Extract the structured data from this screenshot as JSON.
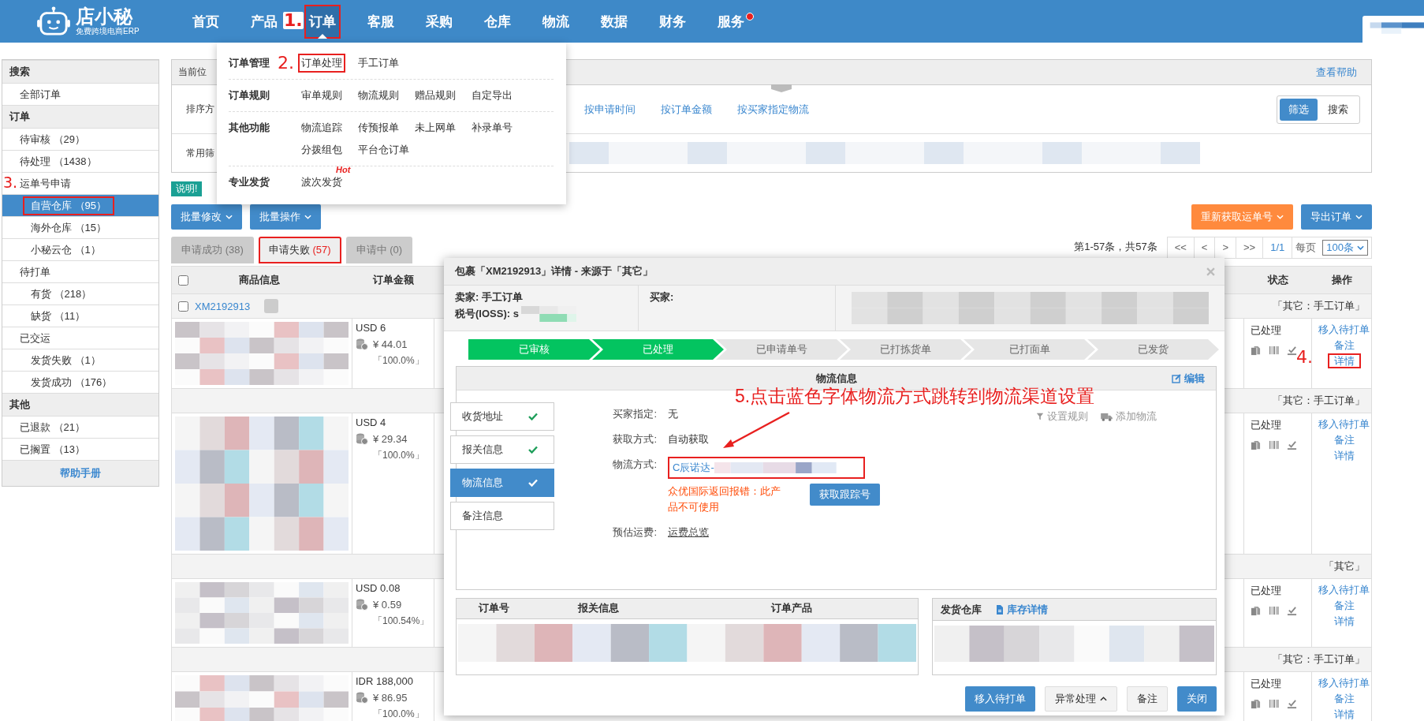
{
  "nav": {
    "logo_name": "店小秘",
    "logo_tagline": "免费跨境电商ERP",
    "items": [
      {
        "label": "首页",
        "selected": false,
        "highlighted": false,
        "notification": false
      },
      {
        "label": "产品",
        "selected": false,
        "highlighted": false,
        "notification": false
      },
      {
        "label": "订单",
        "selected": true,
        "highlighted": true,
        "notification": false,
        "annotation": "1."
      },
      {
        "label": "客服",
        "selected": false,
        "highlighted": false,
        "notification": false
      },
      {
        "label": "采购",
        "selected": false,
        "highlighted": false,
        "notification": false
      },
      {
        "label": "仓库",
        "selected": false,
        "highlighted": false,
        "notification": false
      },
      {
        "label": "物流",
        "selected": false,
        "highlighted": false,
        "notification": false
      },
      {
        "label": "数据",
        "selected": false,
        "highlighted": false,
        "notification": false
      },
      {
        "label": "财务",
        "selected": false,
        "highlighted": false,
        "notification": false
      },
      {
        "label": "服务",
        "selected": false,
        "highlighted": false,
        "notification": true
      }
    ]
  },
  "nav_menu": {
    "groups": [
      {
        "heading": "订单管理",
        "annotation": "2.",
        "lines": [
          [
            {
              "label": "订单处理",
              "highlighted": true
            },
            {
              "label": "手工订单",
              "highlighted": false
            }
          ]
        ]
      },
      {
        "heading": "订单规则",
        "lines": [
          [
            {
              "label": "审单规则",
              "highlighted": false
            },
            {
              "label": "物流规则",
              "highlighted": false
            },
            {
              "label": "赠品规则",
              "highlighted": false
            },
            {
              "label": "自定导出",
              "highlighted": false
            }
          ]
        ]
      },
      {
        "heading": "其他功能",
        "lines": [
          [
            {
              "label": "物流追踪",
              "highlighted": false
            },
            {
              "label": "传预报单",
              "highlighted": false
            },
            {
              "label": "未上网单",
              "highlighted": false
            },
            {
              "label": "补录单号",
              "highlighted": false
            }
          ],
          [
            {
              "label": "分拨组包",
              "highlighted": false
            },
            {
              "label": "平台仓订单",
              "highlighted": false
            }
          ]
        ]
      },
      {
        "heading": "专业发货",
        "lines": [
          [
            {
              "label": "波次发货",
              "highlighted": false,
              "tag": "Hot"
            }
          ]
        ]
      }
    ]
  },
  "sidebar": {
    "sections": [
      {
        "heading": "搜索",
        "items": [
          {
            "label": "全部订单",
            "selected": false,
            "highlighted": false
          }
        ]
      },
      {
        "heading": "订单",
        "items": [
          {
            "label": "待审核 （29）",
            "selected": false,
            "highlighted": false
          },
          {
            "label": "待处理 （1438）",
            "selected": false,
            "highlighted": false
          },
          {
            "label": "运单号申请",
            "selected": false,
            "highlighted": false,
            "annotation": "3.",
            "children": [
              {
                "label": "自营仓库 （95）",
                "selected": true,
                "highlighted": true
              },
              {
                "label": "海外仓库 （15）",
                "selected": false,
                "highlighted": false
              },
              {
                "label": "小秘云仓 （1）",
                "selected": false,
                "highlighted": false
              }
            ]
          },
          {
            "label": "待打单",
            "selected": false,
            "highlighted": false,
            "children": [
              {
                "label": "有货 （218）",
                "selected": false,
                "highlighted": false
              },
              {
                "label": "缺货 （11）",
                "selected": false,
                "highlighted": false
              }
            ]
          },
          {
            "label": "已交运",
            "selected": false,
            "highlighted": false,
            "children": [
              {
                "label": "发货失败 （1）",
                "selected": false,
                "highlighted": false
              },
              {
                "label": "发货成功 （176）",
                "selected": false,
                "highlighted": false
              }
            ]
          }
        ]
      },
      {
        "heading": "其他",
        "items": [
          {
            "label": "已退款 （21）",
            "selected": false,
            "highlighted": false
          },
          {
            "label": "已搁置 （13）",
            "selected": false,
            "highlighted": false
          }
        ]
      }
    ],
    "help": "帮助手册"
  },
  "breadcrumb": {
    "label": "当前位",
    "help": "查看帮助"
  },
  "filters": {
    "sort_label": "排序方",
    "sort_options": [
      "按申请时间",
      "按订单金额",
      "按买家指定物流"
    ],
    "common_label": "常用筛",
    "modes": [
      {
        "label": "筛选",
        "selected": true
      },
      {
        "label": "搜索",
        "selected": false
      }
    ]
  },
  "notice": "说明!",
  "bulk_buttons": [
    "批量修改",
    "批量操作"
  ],
  "actions": [
    {
      "label": "重新获取运单号",
      "kind": "warning"
    },
    {
      "label": "导出订单",
      "kind": "primary"
    }
  ],
  "tabs": [
    {
      "label": "申请成功",
      "count": "(38)",
      "selected": false,
      "highlighted": false
    },
    {
      "label": "申请失败",
      "count": "(57)",
      "selected": true,
      "highlighted": true
    },
    {
      "label": "申请中",
      "count": "(0)",
      "selected": false,
      "highlighted": false
    }
  ],
  "pagination": {
    "summary": "第1-57条，共57条",
    "buttons": [
      "<<",
      "<",
      ">",
      ">>"
    ],
    "page": "1/1",
    "per_page_label": "每页",
    "per_page": "100条"
  },
  "table": {
    "select_all_checked": false,
    "columns": [
      "商品信息",
      "订单金额",
      "状态",
      "操作"
    ],
    "groups": [
      {
        "order_no": "XM2192913",
        "checked": false,
        "source": "「其它：手工订单」",
        "amount": "USD 6",
        "cny": "¥ 44.01",
        "ratio": "「100.0%」",
        "status": "已处理",
        "actions": [
          {
            "label": "移入待打单",
            "highlighted": false
          },
          {
            "label": "备注",
            "highlighted": false
          },
          {
            "label": "详情",
            "highlighted": true,
            "annotation": "4."
          }
        ]
      },
      {
        "source": "「其它：手工订单」",
        "amount": "USD 4",
        "cny": "¥ 29.34",
        "ratio": "「100.0%」",
        "status": "已处理",
        "actions": [
          {
            "label": "移入待打单",
            "highlighted": false
          },
          {
            "label": "备注",
            "highlighted": false
          },
          {
            "label": "详情",
            "highlighted": false
          }
        ]
      },
      {
        "source": "「其它」",
        "amount": "USD 0.08",
        "cny": "¥ 0.59",
        "ratio": "「100.54%」",
        "status": "已处理",
        "actions": [
          {
            "label": "移入待打单",
            "highlighted": false
          },
          {
            "label": "备注",
            "highlighted": false
          },
          {
            "label": "详情",
            "highlighted": false
          }
        ]
      },
      {
        "source": "「其它：手工订单」",
        "amount": "IDR 188,000",
        "cny": "¥ 86.95",
        "ratio": "「100.0%」",
        "status": "已处理",
        "actions": [
          {
            "label": "移入待打单",
            "highlighted": false
          },
          {
            "label": "备注",
            "highlighted": false
          },
          {
            "label": "详情",
            "highlighted": false
          }
        ]
      }
    ]
  },
  "dialog": {
    "title": "包裹「XM2192913」详情 - 来源于「其它」",
    "seller": "卖家: 手工订单",
    "tax_id": "税号(IOSS): s",
    "buyer": "买家:",
    "steps": [
      {
        "label": "已审核",
        "done": true
      },
      {
        "label": "已处理",
        "done": true
      },
      {
        "label": "已申请单号",
        "done": false
      },
      {
        "label": "已打拣货单",
        "done": false
      },
      {
        "label": "已打面单",
        "done": false
      },
      {
        "label": "已发货",
        "done": false
      }
    ],
    "panel_title": "物流信息",
    "edit": "编辑",
    "side_tabs": [
      {
        "label": "收货地址",
        "checked": true,
        "selected": false
      },
      {
        "label": "报关信息",
        "checked": true,
        "selected": false
      },
      {
        "label": "物流信息",
        "checked": true,
        "selected": true
      },
      {
        "label": "备注信息",
        "checked": false,
        "selected": false
      }
    ],
    "tools": [
      {
        "label": "设置规则",
        "kind": "rule"
      },
      {
        "label": "添加物流",
        "kind": "truck"
      }
    ],
    "fields": [
      {
        "kind": "text",
        "label": "买家指定:",
        "value": "无"
      },
      {
        "kind": "text",
        "label": "获取方式:",
        "value": "自动获取"
      },
      {
        "kind": "logistics",
        "label": "物流方式:",
        "value": "C辰诺达-",
        "highlighted": true,
        "error": "众优国际返回报错：此产品不可使用",
        "button": "获取跟踪号"
      },
      {
        "kind": "link",
        "label": "预估运费:",
        "value": "运费总览"
      }
    ],
    "order_columns": [
      "订单号",
      "报关信息",
      "订单产品"
    ],
    "warehouse_label": "发货仓库",
    "stock_link": "库存详情",
    "buttons": [
      {
        "label": "移入待打单",
        "kind": "primary"
      },
      {
        "label": "异常处理",
        "kind": "menu"
      },
      {
        "label": "备注",
        "kind": "default"
      },
      {
        "label": "关闭",
        "kind": "primary"
      }
    ],
    "note": "5.点击蓝色字体物流方式跳转到物流渠道设置"
  }
}
